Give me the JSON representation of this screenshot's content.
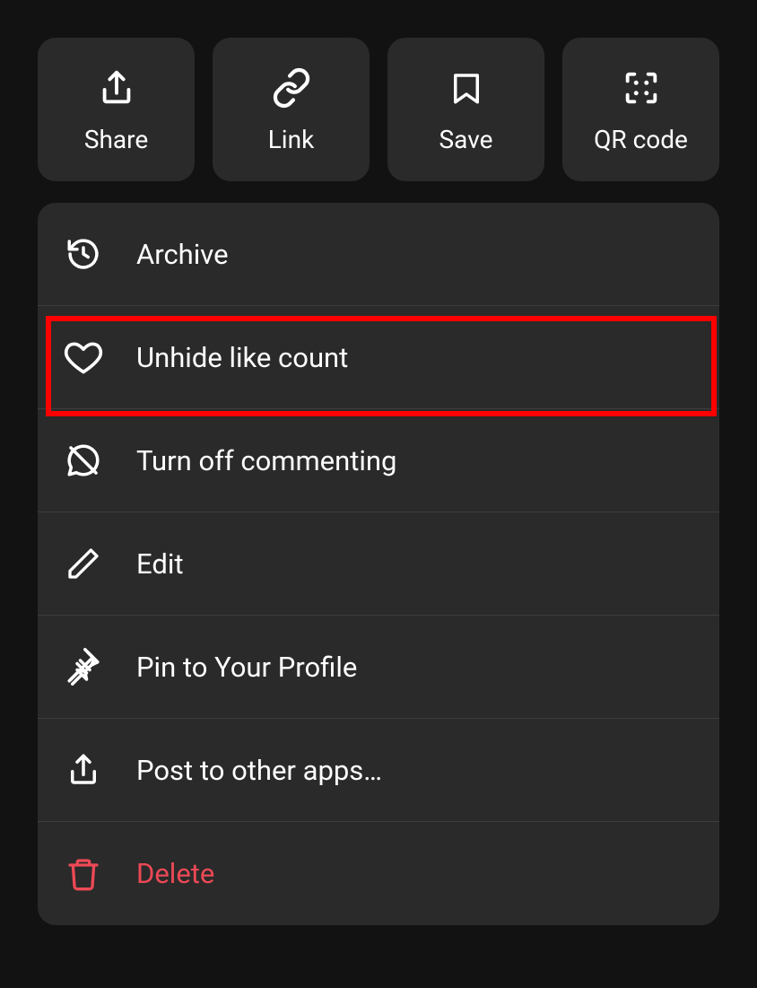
{
  "top": {
    "share": "Share",
    "link": "Link",
    "save": "Save",
    "qr": "QR code"
  },
  "menu": {
    "archive": "Archive",
    "unhide": "Unhide like count",
    "comment_off": "Turn off commenting",
    "edit": "Edit",
    "pin": "Pin to Your Profile",
    "post_other": "Post to other apps…",
    "delete": "Delete"
  }
}
